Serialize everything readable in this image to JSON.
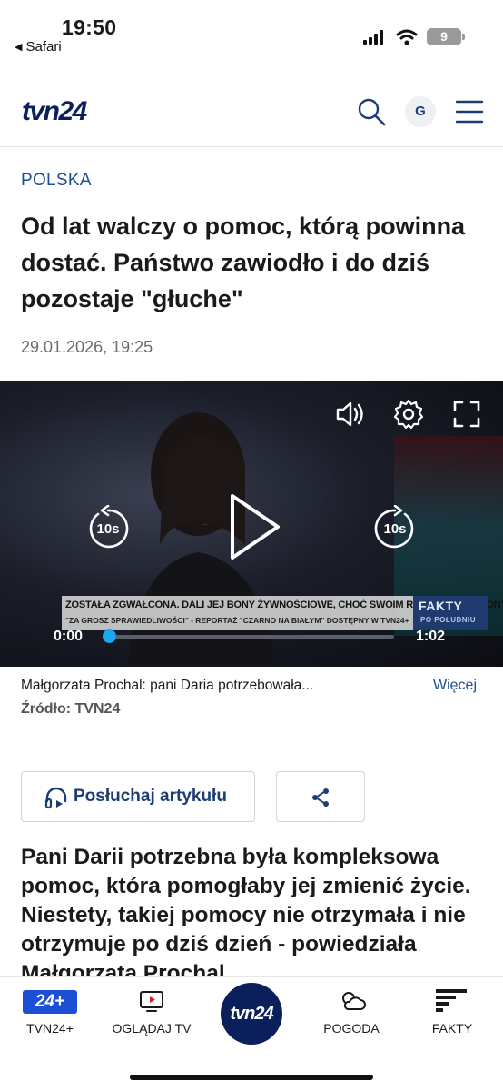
{
  "status_bar": {
    "time": "19:50",
    "back_app": "Safari",
    "battery": "9"
  },
  "header": {
    "logo": "tvn24",
    "avatar_letter": "G",
    "icons": [
      "search-icon",
      "menu-icon"
    ]
  },
  "article": {
    "category": "POLSKA",
    "headline": "Od lat walczy o pomoc, którą powinna dostać. Państwo zawiodło i do dziś pozostaje \"głuche\"",
    "date": "29.01.2026, 19:25",
    "lead": "Pani Darii potrzebna była kompleksowa pomoc, która pomogłaby jej zmienić życie. Niestety, takiej pomocy nie otrzymała i nie otrzymuje po dziś dzień - powiedziała Małgorzata Prochal"
  },
  "video": {
    "ticker_line1": "ZOSTAŁA ZGWAŁCONA. DALI JEJ BONY ŻYWNOŚCIOWE, CHOĆ SWOIM ROZDAWALI MILIONY",
    "ticker_line2": "\"ZA GROSZ SPRAWIEDLIWOŚCI\" - REPORTAŻ \"CZARNO NA BIAŁYM\" DOSTĘPNY W TVN24+",
    "channel_title": "FAKTY",
    "channel_subtitle": "PO POŁUDNIU",
    "current_time": "0:00",
    "duration": "1:02",
    "progress_fraction": 0.0,
    "skip_back": "10s",
    "skip_forward": "10s",
    "accent_color": "#1aa7ef"
  },
  "caption": {
    "text": "Małgorzata Prochal: pani Daria potrzebowała...",
    "more_label": "Więcej",
    "source_label": "Źródło: TVN24"
  },
  "actions": {
    "listen_label": "Posłuchaj artykułu"
  },
  "bottom_nav": {
    "items": [
      {
        "label": "TVN24+",
        "icon": "tvn24plus-logo"
      },
      {
        "label": "OGLĄDAJ TV",
        "icon": "tv-play-icon"
      },
      {
        "label": "tvn24",
        "icon": "tvn24-home-logo"
      },
      {
        "label": "POGODA",
        "icon": "weather-cloud-icon"
      },
      {
        "label": "FAKTY",
        "icon": "fakty-logo"
      }
    ],
    "tvn24plus_badge": "24+"
  },
  "colors": {
    "brand_navy": "#0a1f5c",
    "link_blue": "#1c4e94"
  }
}
